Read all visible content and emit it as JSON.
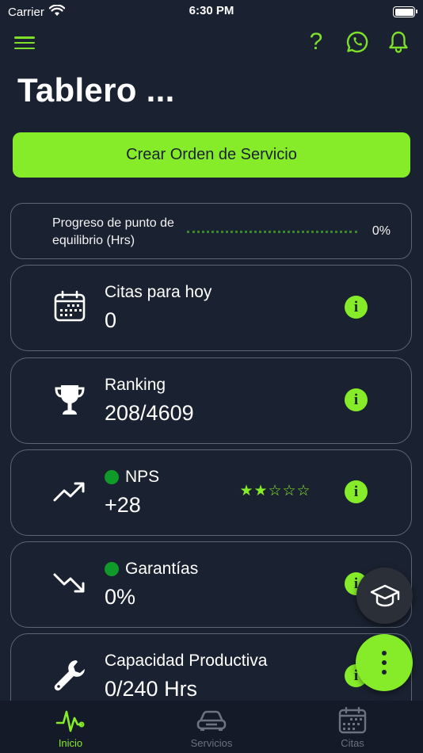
{
  "status_bar": {
    "carrier": "Carrier",
    "time": "6:30 PM"
  },
  "header": {
    "title": "Tablero ..."
  },
  "top_icons": [
    "menu-icon",
    "help-icon",
    "whatsapp-icon",
    "bell-icon"
  ],
  "help_glyph": "?",
  "create_button": {
    "label": "Crear Orden de Servicio"
  },
  "progress": {
    "label": "Progreso de punto de equilibrio (Hrs)",
    "value_text": "0%",
    "fraction": 0
  },
  "cards": [
    {
      "title": "Citas para hoy",
      "value": "0",
      "icon": "calendar-icon"
    },
    {
      "title": "Ranking",
      "value": "208/4609",
      "icon": "trophy-icon"
    },
    {
      "title": "NPS",
      "value": "+28",
      "icon": "trend-up-icon",
      "status_color": "#0f9a2a",
      "rating": 2,
      "rating_max": 5
    },
    {
      "title": "Garantías",
      "value": "0%",
      "icon": "trend-down-icon",
      "status_color": "#0f9a2a"
    },
    {
      "title": "Capacidad Productiva",
      "value": "0/240 Hrs",
      "icon": "wrench-icon"
    }
  ],
  "info_glyph": "i",
  "stars": {
    "filled": "★",
    "empty": "☆"
  },
  "tabs": [
    {
      "label": "Inicio",
      "icon": "activity-icon",
      "active": true
    },
    {
      "label": "Servicios",
      "icon": "car-icon",
      "active": false
    },
    {
      "label": "Citas",
      "icon": "calendar-icon",
      "active": false
    }
  ],
  "colors": {
    "accent": "#86ec29",
    "background": "#1a2130",
    "tab_bar": "#141a27",
    "inactive": "#6b7280"
  }
}
